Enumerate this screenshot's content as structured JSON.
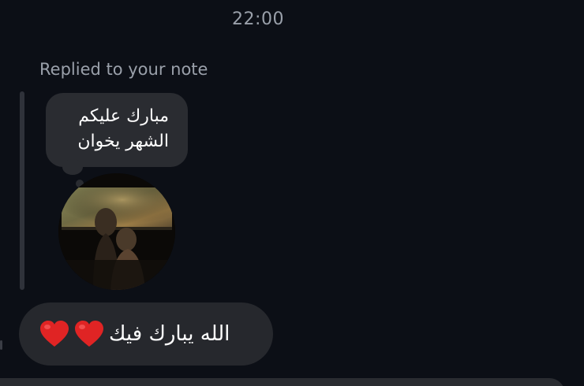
{
  "chat": {
    "timestamp": "22:00",
    "reply_label": "Replied to your note",
    "note": {
      "text": "مبارك عليكم\nالشهر يخوان"
    },
    "message": {
      "text": "الله يبارك فيك",
      "hearts": [
        "red-heart-icon",
        "red-heart-icon"
      ]
    }
  },
  "colors": {
    "background": "#0c0f16",
    "bubble": "#26282d",
    "secondary_text": "#9aa0aa",
    "heart": "#e02424"
  }
}
